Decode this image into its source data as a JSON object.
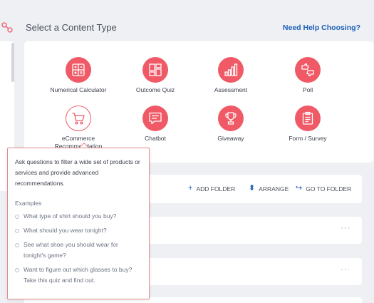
{
  "header": {
    "title": "Select a Content Type",
    "help_link": "Need Help Choosing?"
  },
  "content_types": [
    {
      "label": "Numerical Calculator",
      "icon": "calculator-icon"
    },
    {
      "label": "Outcome Quiz",
      "icon": "outcome-grid-icon"
    },
    {
      "label": "Assessment",
      "icon": "bar-chart-icon"
    },
    {
      "label": "Poll",
      "icon": "thumbs-icon"
    },
    {
      "label": "eCommerce Recommendation",
      "icon": "shopping-cart-icon"
    },
    {
      "label": "Chatbot",
      "icon": "chat-bubble-icon"
    },
    {
      "label": "Giveaway",
      "icon": "trophy-icon"
    },
    {
      "label": "Form / Survey",
      "icon": "clipboard-icon"
    }
  ],
  "toolbar": {
    "add_folder": "ADD FOLDER",
    "arrange": "ARRANGE",
    "go_to_folder": "GO TO FOLDER"
  },
  "rows": [
    {
      "more": "···"
    },
    {
      "more": "···"
    }
  ],
  "tooltip": {
    "description": "Ask questions to filter a wide set of products or services and provide advanced recommendations.",
    "examples_heading": "Examples",
    "examples": [
      "What type of shirt should you buy?",
      "What should you wear tonight?",
      "See what shoe you should wear for tonight's game?",
      "Want to figure out which glasses to buy? Take this quiz and find out."
    ]
  },
  "colors": {
    "accent": "#ef5a66",
    "link": "#1b5fb5",
    "background": "#eef0f4"
  }
}
